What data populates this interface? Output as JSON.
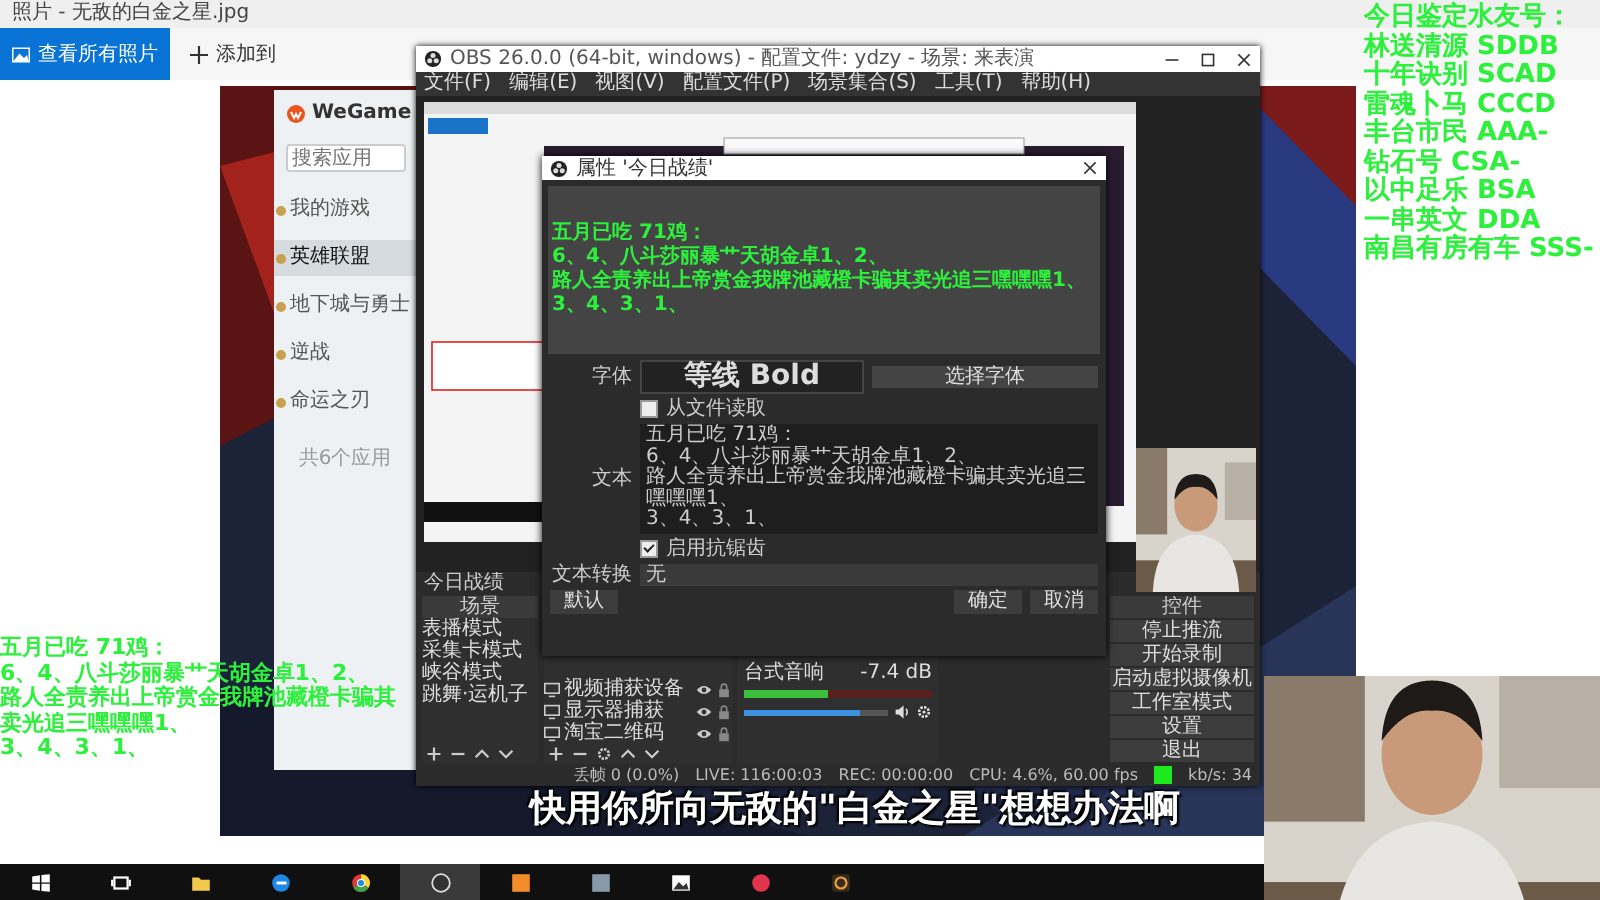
{
  "viewer": {
    "title": "照片 - 无敌的白金之星.jpg",
    "all_photos_button": "查看所有照片",
    "add_button": "添加到"
  },
  "wegame": {
    "logo": "WeGame",
    "search_placeholder": "搜索应用",
    "items": [
      {
        "label": "我的游戏",
        "selected": false
      },
      {
        "label": "英雄联盟",
        "selected": true
      },
      {
        "label": "地下城与勇士",
        "selected": false
      },
      {
        "label": "逆战",
        "selected": false
      },
      {
        "label": "命运之刃",
        "selected": false
      }
    ],
    "footer": "共6个应用"
  },
  "obs": {
    "title": "OBS 26.0.0 (64-bit, windows) - 配置文件: ydzy - 场景: 来表演",
    "menu": [
      "文件(F)",
      "编辑(E)",
      "视图(V)",
      "配置文件(P)",
      "场景集合(S)",
      "工具(T)",
      "帮助(H)"
    ],
    "dock_title": "今日战绩",
    "scenes": {
      "header": "场景",
      "items": [
        "表播模式",
        "采集卡模式",
        "峡谷模式",
        "跳舞·运机子"
      ]
    },
    "sources": [
      "视频捕获设备",
      "显示器捕获",
      "淘宝二维码"
    ],
    "mixer": {
      "name": "台式音响",
      "reading": "-7.4 dB",
      "meter": {
        "level": 0.45
      },
      "volume": {
        "level": 0.8
      }
    },
    "controls": {
      "header": "控件",
      "buttons": [
        "停止推流",
        "开始录制",
        "启动虚拟摄像机",
        "工作室模式",
        "设置",
        "退出"
      ]
    },
    "status": [
      "丢帧 0 (0.0%)",
      "LIVE: 116:00:03",
      "REC: 00:00:00",
      "CPU: 4.6%, 60.00 fps",
      "kb/s: 34"
    ]
  },
  "dialog": {
    "title": "属性 '今日战绩'",
    "preview_lines": [
      "五月已吃 71鸡：",
      "6、4、八斗莎丽暴艹天胡金卓1、2、",
      "路人全责养出上帝赏金我牌池藏橙卡骗其卖光追三嘿嘿嘿1、",
      "3、4、3、1、"
    ],
    "font_label": "字体",
    "font_value": "等线 Bold",
    "font_button": "选择字体",
    "from_file": {
      "label": "从文件读取",
      "checked": false
    },
    "text_label": "文本",
    "text_lines": [
      "五月已吃 71鸡：",
      "6、4、八斗莎丽暴艹天胡金卓1、2、",
      "路人全责养出上帝赏金我牌池藏橙卡骗其卖光追三嘿嘿嘿1、",
      "3、4、3、1、"
    ],
    "antialias": {
      "label": "启用抗锯齿",
      "checked": true
    },
    "transform_label": "文本转换",
    "transform_value": "无",
    "buttons": [
      {
        "label": "默认",
        "kind": "left"
      },
      {
        "label": "确定",
        "kind": "right"
      },
      {
        "label": "取消",
        "kind": "right"
      }
    ]
  },
  "subtitle": "快用你所向无敌的\"白金之星\"想想办法啊",
  "overlay_left": [
    "五月已吃 71鸡：",
    "6、4、八斗莎丽暴艹天胡金卓1、2、",
    "路人全责养出上帝赏金我牌池藏橙卡骗其卖光追三嘿嘿嘿1、",
    "3、4、3、1、"
  ],
  "overlay_right": [
    "今日鉴定水友号：",
    "林送清源 SDDB",
    "十年诀别 SCAD",
    "雷魂卜马 CCCD",
    "丰台市民 AAA-",
    "钻石号 CSA-",
    "以中足乐 BSA",
    "一串英文 DDA",
    "南昌有房有车 SSS-"
  ]
}
